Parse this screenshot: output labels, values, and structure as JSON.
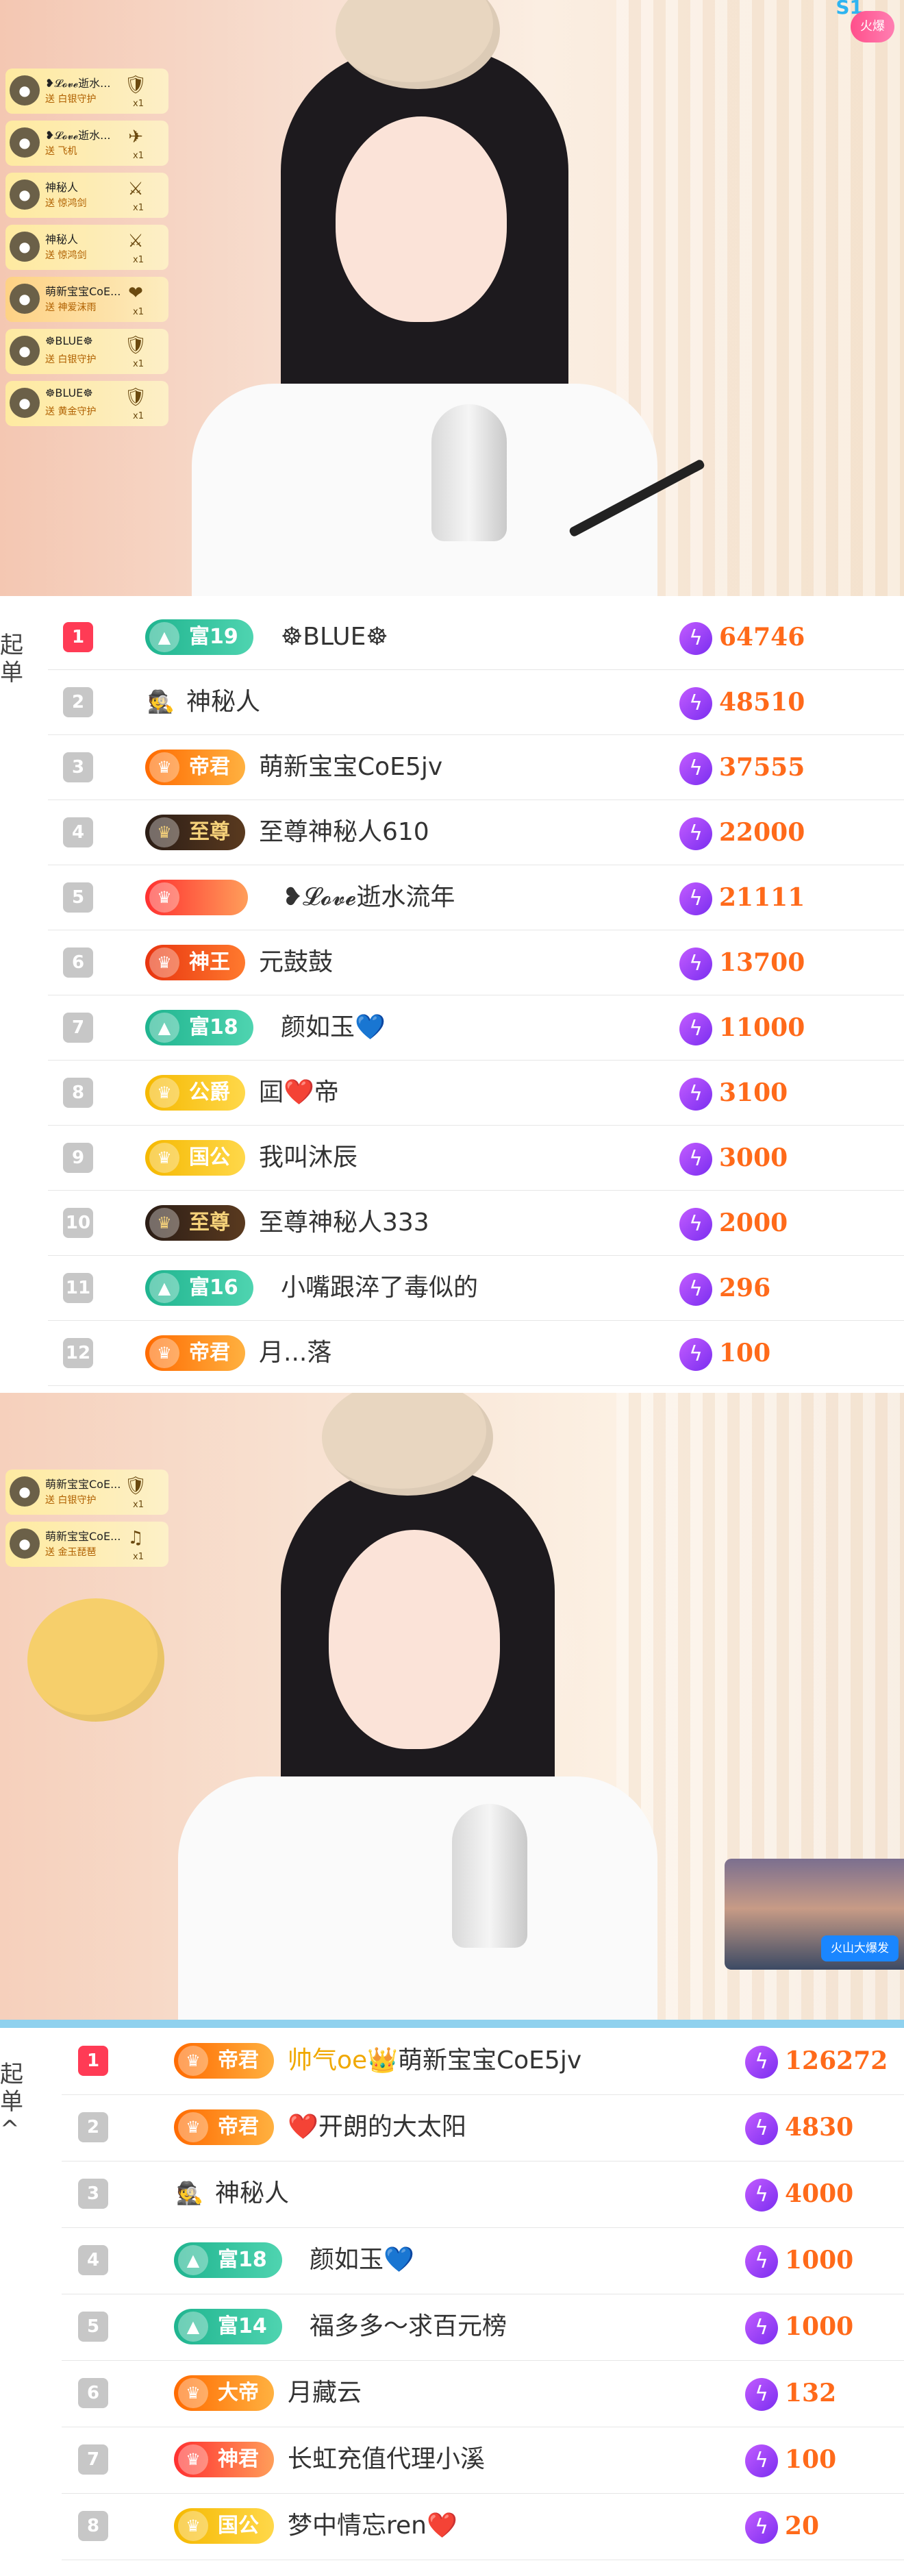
{
  "top_stream": {
    "top_badge": "火爆",
    "gifts": [
      {
        "name": "❥𝓛𝓸𝓿𝓮逝水...",
        "sub": "送 白银守护",
        "count": "x1",
        "icon": "shield-icon"
      },
      {
        "name": "❥𝓛𝓸𝓿𝓮逝水...",
        "sub": "送 飞机",
        "count": "x1",
        "icon": "plane-icon"
      },
      {
        "name": "神秘人",
        "sub": "送 惊鸿剑",
        "count": "x1",
        "icon": "sword-icon"
      },
      {
        "name": "神秘人",
        "sub": "送 惊鸿剑",
        "count": "x1",
        "icon": "sword-icon"
      },
      {
        "name": "萌新宝宝CoE...",
        "sub": "送 神爱沫雨",
        "count": "x1",
        "icon": "heart-gift-icon"
      },
      {
        "name": "☸BLUE☸",
        "sub": "送 白银守护",
        "count": "x1",
        "icon": "shield-icon"
      },
      {
        "name": "☸BLUE☸",
        "sub": "送 黄金守护",
        "count": "x1",
        "icon": "gold-shield-icon"
      }
    ]
  },
  "ranking1": {
    "side_label": "起\n单",
    "rows": [
      {
        "rank": "1",
        "level": "富19",
        "level_style": "green",
        "name": "☸BLUE☸",
        "score": "64746"
      },
      {
        "rank": "2",
        "level": "",
        "level_style": "",
        "avatar": "mystery-avatar",
        "name": "神秘人",
        "score": "48510"
      },
      {
        "rank": "3",
        "level": "帝君",
        "level_style": "orange",
        "name": "萌新宝宝CoE5jv",
        "score": "37555"
      },
      {
        "rank": "4",
        "level": "至尊",
        "level_style": "dark",
        "name": "至尊神秘人610",
        "score": "22000"
      },
      {
        "rank": "5",
        "level": "",
        "level_style": "crimson",
        "name": "❥𝓛𝓸𝓿𝓮逝水流年",
        "score": "21111"
      },
      {
        "rank": "6",
        "level": "神王",
        "level_style": "red",
        "name": "元鼓鼓",
        "score": "13700"
      },
      {
        "rank": "7",
        "level": "富18",
        "level_style": "green",
        "name": "颜如玉💙",
        "score": "11000"
      },
      {
        "rank": "8",
        "level": "公爵",
        "level_style": "gold",
        "name": "囸❤️帝",
        "score": "3100"
      },
      {
        "rank": "9",
        "level": "国公",
        "level_style": "gold",
        "name": "我叫沐辰",
        "score": "3000"
      },
      {
        "rank": "10",
        "level": "至尊",
        "level_style": "dark",
        "name": "至尊神秘人333",
        "score": "2000"
      },
      {
        "rank": "11",
        "level": "富16",
        "level_style": "green",
        "name": "小嘴跟淬了毒似的",
        "score": "296"
      },
      {
        "rank": "12",
        "level": "帝君",
        "level_style": "orange",
        "name": "月...落",
        "score": "100"
      }
    ]
  },
  "bottom_stream": {
    "pip_badge": "火山大爆发",
    "gifts": [
      {
        "name": "萌新宝宝CoE...",
        "sub": "送 白银守护",
        "count": "x1",
        "icon": "shield-icon"
      },
      {
        "name": "萌新宝宝CoE...",
        "sub": "送 金玉琵琶",
        "count": "x1",
        "icon": "pipa-icon"
      }
    ]
  },
  "ranking2": {
    "side_label": "起\n单\n^",
    "rows": [
      {
        "rank": "1",
        "level": "帝君",
        "level_style": "orange",
        "name_prefix": "帅气oe👑",
        "name": "萌新宝宝CoE5jv",
        "score": "126272"
      },
      {
        "rank": "2",
        "level": "帝君",
        "level_style": "orange",
        "name": "❤️开朗的大太阳",
        "score": "4830"
      },
      {
        "rank": "3",
        "level": "",
        "level_style": "",
        "avatar": "mystery-avatar",
        "name": "神秘人",
        "score": "4000"
      },
      {
        "rank": "4",
        "level": "富18",
        "level_style": "green",
        "name": "颜如玉💙",
        "score": "1000"
      },
      {
        "rank": "5",
        "level": "富14",
        "level_style": "green",
        "name": "福多多～求百元榜",
        "score": "1000"
      },
      {
        "rank": "6",
        "level": "大帝",
        "level_style": "orange",
        "name": "月藏云",
        "score": "132"
      },
      {
        "rank": "7",
        "level": "神君",
        "level_style": "crimson",
        "name": "长虹充值代理小溪",
        "score": "100"
      },
      {
        "rank": "8",
        "level": "国公",
        "level_style": "gold",
        "name": "梦中情忘ren❤️",
        "score": "20"
      }
    ]
  }
}
